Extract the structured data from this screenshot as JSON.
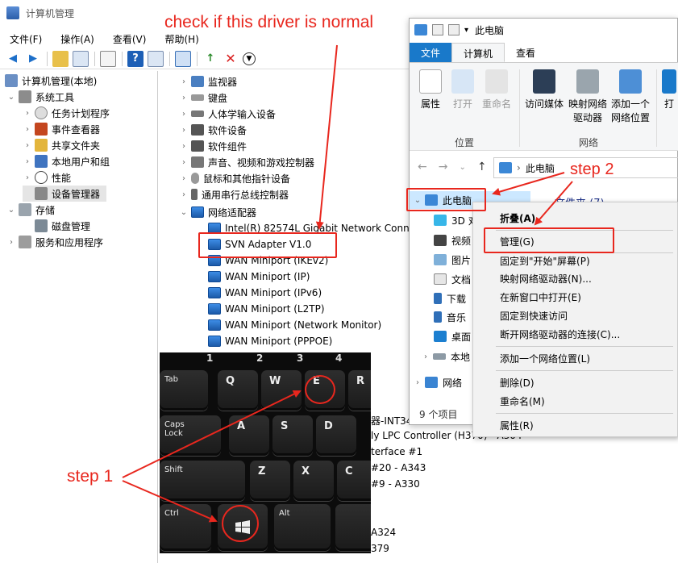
{
  "cm": {
    "title": "计算机管理",
    "menu": [
      "文件(F)",
      "操作(A)",
      "查看(V)",
      "帮助(H)"
    ],
    "tree": [
      {
        "label": "计算机管理(本地)"
      },
      {
        "label": "系统工具"
      },
      {
        "label": "任务计划程序"
      },
      {
        "label": "事件查看器"
      },
      {
        "label": "共享文件夹"
      },
      {
        "label": "本地用户和组"
      },
      {
        "label": "性能"
      },
      {
        "label": "设备管理器"
      },
      {
        "label": "存储"
      },
      {
        "label": "磁盘管理"
      },
      {
        "label": "服务和应用程序"
      }
    ],
    "devices": [
      {
        "label": "监视器"
      },
      {
        "label": "键盘"
      },
      {
        "label": "人体学输入设备"
      },
      {
        "label": "软件设备"
      },
      {
        "label": "软件组件"
      },
      {
        "label": "声音、视频和游戏控制器"
      },
      {
        "label": "鼠标和其他指针设备"
      },
      {
        "label": "通用串行总线控制器"
      },
      {
        "label": "网络适配器"
      }
    ],
    "adapters": [
      {
        "label": "Intel(R) 82574L Gigabit Network Connection"
      },
      {
        "label": "SVN Adapter V1.0"
      },
      {
        "label": "WAN Miniport (IKEv2)"
      },
      {
        "label": "WAN Miniport (IP)"
      },
      {
        "label": "WAN Miniport (IPv6)"
      },
      {
        "label": "WAN Miniport (L2TP)"
      },
      {
        "label": "WAN Miniport (Network Monitor)"
      },
      {
        "label": "WAN Miniport (PPPOE)"
      }
    ],
    "partial_rows": [
      "器-INT34",
      "ly LPC Controller (H370) - A304",
      "terface #1",
      "#20 - A343",
      "#9 - A330",
      "A324",
      "379"
    ]
  },
  "keyboard": {
    "digits": [
      "1",
      "2",
      "3",
      "4"
    ],
    "keys": [
      "Tab",
      "Q",
      "W",
      "E",
      "R",
      "Caps Lock",
      "A",
      "S",
      "D",
      "Shift",
      "Z",
      "X",
      "C",
      "Ctrl",
      "Alt"
    ]
  },
  "explorer": {
    "title": "此电脑",
    "tabs": [
      "文件",
      "计算机",
      "查看"
    ],
    "ribbon": {
      "buttons": [
        "属性",
        "打开",
        "重命名",
        "访问媒体",
        "映射网络驱动器",
        "添加一个网络位置",
        "打"
      ],
      "groups": [
        "位置",
        "网络"
      ]
    },
    "address": "此电脑",
    "folders_header": "文件夹 (7)",
    "nav": [
      "此电脑",
      "3D 对",
      "视频",
      "图片",
      "文档",
      "下载",
      "音乐",
      "桌面",
      "本地",
      "网络"
    ],
    "status": "9 个项目"
  },
  "context_menu": {
    "items": [
      "折叠(A)",
      "管理(G)",
      "固定到\"开始\"屏幕(P)",
      "映射网络驱动器(N)...",
      "在新窗口中打开(E)",
      "固定到快速访问",
      "断开网络驱动器的连接(C)...",
      "添加一个网络位置(L)",
      "删除(D)",
      "重命名(M)",
      "属性(R)"
    ]
  },
  "annotations": {
    "check_driver": "check if this driver is normal",
    "step1": "step 1",
    "step2": "step 2"
  },
  "colors": {
    "annotation": "#e8271e",
    "file_tab": "#1979ca",
    "nav_selected": "#cce8ff"
  }
}
